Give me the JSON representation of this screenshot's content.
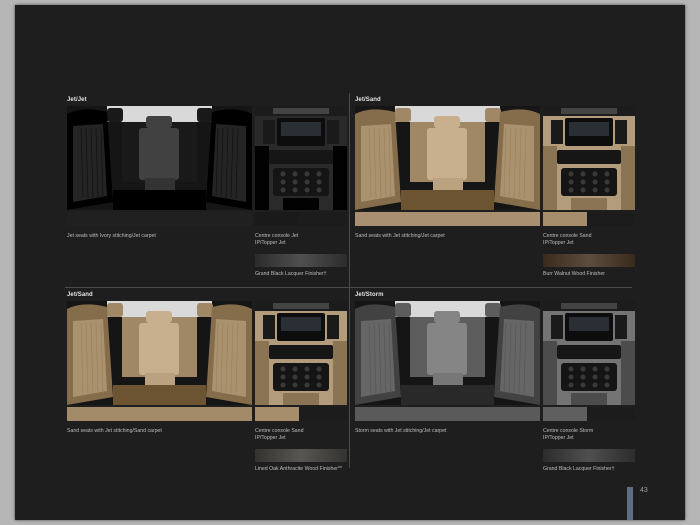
{
  "page_number": "43",
  "colors": {
    "page_bg": "#1e1e1e",
    "outer_bg": "#b6b6b6",
    "jet": "#2b2b2b",
    "sand": "#b29a78",
    "storm": "#6f6f6f",
    "accent_bar": "#5d6f84"
  },
  "panels": [
    {
      "title": "Jet/Jet",
      "seat_caption": "Jet seats with Ivory stitching/Jet carpet",
      "console_caption_line1": "Centre console Jet",
      "console_caption_line2": "IP/Topper Jet",
      "finisher_caption": "Grand Black Lacquer Finisher†",
      "seat_color": "#2b2b2b",
      "seat_swatch_color": "#202020",
      "console_color": "#2a2a2a",
      "console_swatch_color": "#1a1a1a",
      "finisher_color": "#2c2c2c"
    },
    {
      "title": "Jet/Sand",
      "seat_caption": "Sand seats with Jet stitching/Jet carpet",
      "console_caption_line1": "Centre console Sand",
      "console_caption_line2": "IP/Topper Jet",
      "finisher_caption": "Burr Walnut Wood Finisher",
      "seat_color": "#b29a78",
      "seat_swatch_color": "#a89070",
      "console_color": "#b39c7c",
      "console_swatch_color": "#a68d6c",
      "finisher_color": "#3a2a1c"
    },
    {
      "title": "Jet/Sand",
      "seat_caption": "Sand seats with Jet stitching/Sand carpet",
      "console_caption_line1": "Centre console Sand",
      "console_caption_line2": "IP/Topper Jet",
      "finisher_caption": "Lined Oak Anthracite Wood Finisher**",
      "seat_color": "#b29a78",
      "seat_swatch_color": "#a38b6a",
      "console_color": "#b39c7c",
      "console_swatch_color": "#a68d6c",
      "finisher_color": "#35332f"
    },
    {
      "title": "Jet/Storm",
      "seat_caption": "Storm seats with Jet stitching/Jet carpet",
      "console_caption_line1": "Centre console Storm",
      "console_caption_line2": "IP/Topper Jet",
      "finisher_caption": "Grand Black Lacquer Finisher†",
      "seat_color": "#6f6f6f",
      "seat_swatch_color": "#5a5a5a",
      "console_color": "#747474",
      "console_swatch_color": "#5f5f5f",
      "finisher_color": "#2c2c2c"
    }
  ]
}
